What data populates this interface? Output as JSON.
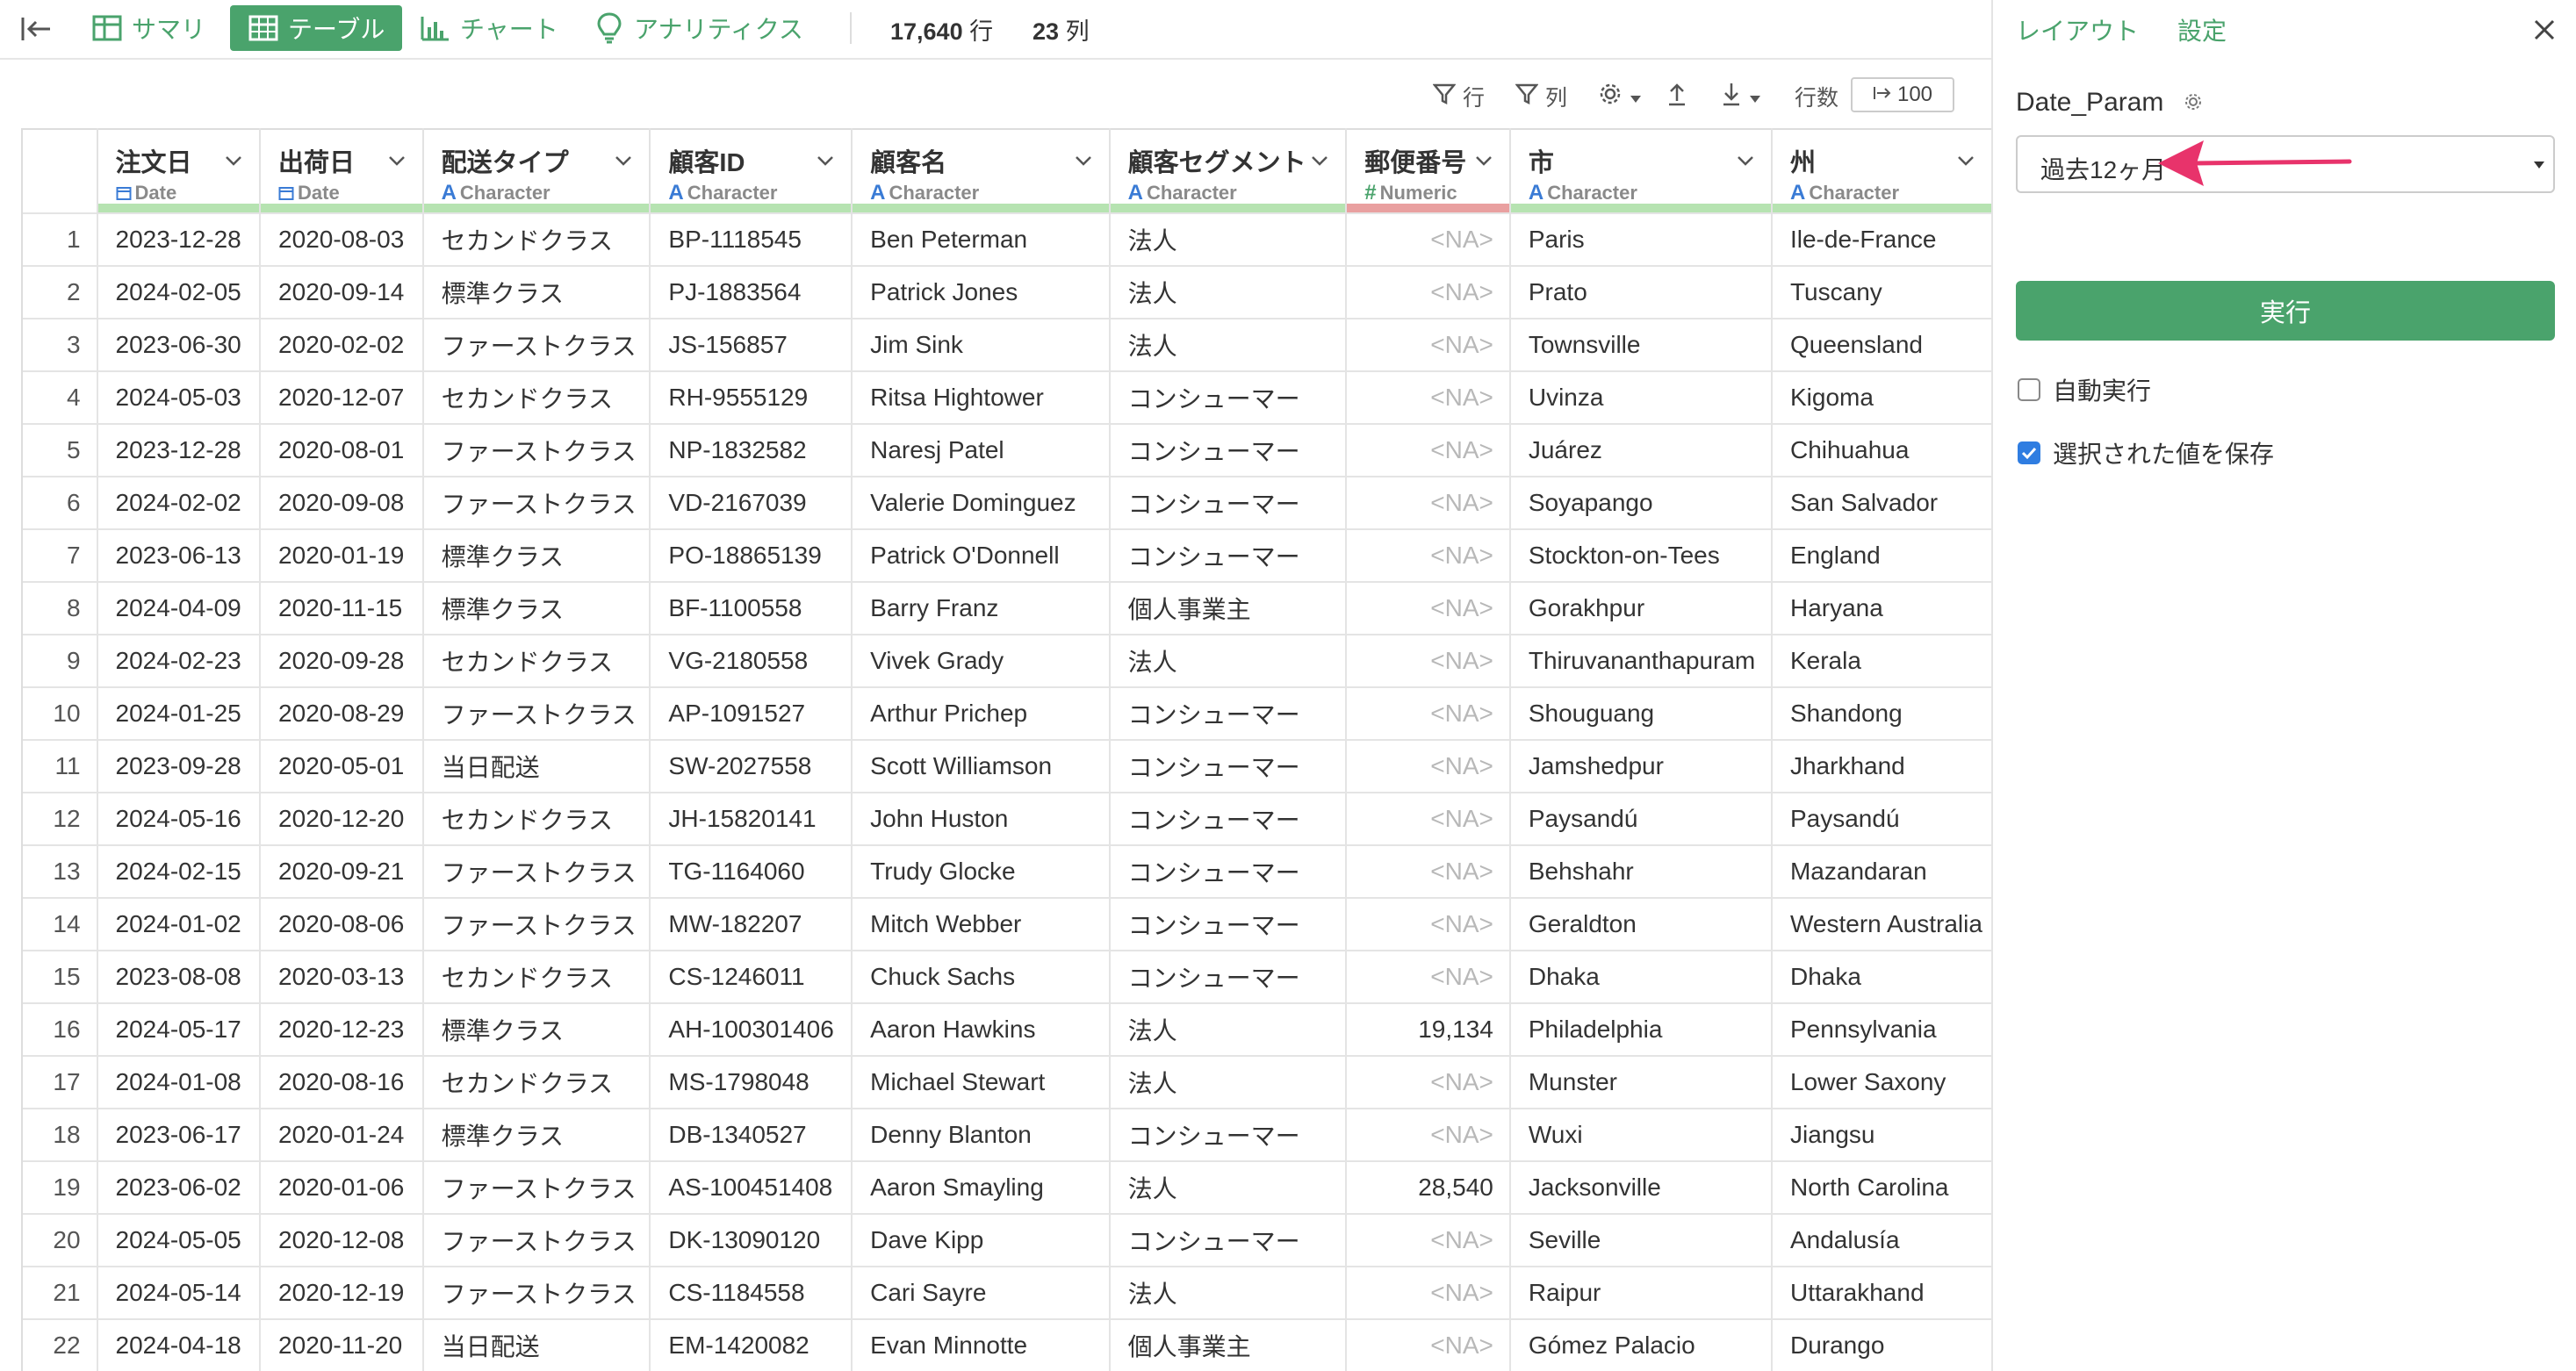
{
  "toolbar": {
    "summary": "サマリ",
    "table": "テーブル",
    "chart": "チャート",
    "analytics": "アナリティクス",
    "rows_value": "17,640",
    "rows_unit": "行",
    "cols_value": "23",
    "cols_unit": "列"
  },
  "subtoolbar": {
    "row_filter": "行",
    "col_filter": "列",
    "rows_label": "行数",
    "limit": "100"
  },
  "table": {
    "columns": [
      {
        "name": "注文日",
        "type": "Date"
      },
      {
        "name": "出荷日",
        "type": "Date"
      },
      {
        "name": "配送タイプ",
        "type": "Character"
      },
      {
        "name": "顧客ID",
        "type": "Character"
      },
      {
        "name": "顧客名",
        "type": "Character"
      },
      {
        "name": "顧客セグメント",
        "type": "Character"
      },
      {
        "name": "郵便番号",
        "type": "Numeric"
      },
      {
        "name": "市",
        "type": "Character"
      },
      {
        "name": "州",
        "type": "Character"
      }
    ],
    "rows": [
      [
        "1",
        "2023-12-28",
        "2020-08-03",
        "セカンドクラス",
        "BP-1118545",
        "Ben Peterman",
        "法人",
        "<NA>",
        "Paris",
        "Ile-de-France"
      ],
      [
        "2",
        "2024-02-05",
        "2020-09-14",
        "標準クラス",
        "PJ-1883564",
        "Patrick Jones",
        "法人",
        "<NA>",
        "Prato",
        "Tuscany"
      ],
      [
        "3",
        "2023-06-30",
        "2020-02-02",
        "ファーストクラス",
        "JS-156857",
        "Jim Sink",
        "法人",
        "<NA>",
        "Townsville",
        "Queensland"
      ],
      [
        "4",
        "2024-05-03",
        "2020-12-07",
        "セカンドクラス",
        "RH-9555129",
        "Ritsa Hightower",
        "コンシューマー",
        "<NA>",
        "Uvinza",
        "Kigoma"
      ],
      [
        "5",
        "2023-12-28",
        "2020-08-01",
        "ファーストクラス",
        "NP-1832582",
        "Naresj Patel",
        "コンシューマー",
        "<NA>",
        "Juárez",
        "Chihuahua"
      ],
      [
        "6",
        "2024-02-02",
        "2020-09-08",
        "ファーストクラス",
        "VD-2167039",
        "Valerie Dominguez",
        "コンシューマー",
        "<NA>",
        "Soyapango",
        "San Salvador"
      ],
      [
        "7",
        "2023-06-13",
        "2020-01-19",
        "標準クラス",
        "PO-18865139",
        "Patrick O'Donnell",
        "コンシューマー",
        "<NA>",
        "Stockton-on-Tees",
        "England"
      ],
      [
        "8",
        "2024-04-09",
        "2020-11-15",
        "標準クラス",
        "BF-1100558",
        "Barry Franz",
        "個人事業主",
        "<NA>",
        "Gorakhpur",
        "Haryana"
      ],
      [
        "9",
        "2024-02-23",
        "2020-09-28",
        "セカンドクラス",
        "VG-2180558",
        "Vivek Grady",
        "法人",
        "<NA>",
        "Thiruvananthapuram",
        "Kerala"
      ],
      [
        "10",
        "2024-01-25",
        "2020-08-29",
        "ファーストクラス",
        "AP-1091527",
        "Arthur Prichep",
        "コンシューマー",
        "<NA>",
        "Shouguang",
        "Shandong"
      ],
      [
        "11",
        "2023-09-28",
        "2020-05-01",
        "当日配送",
        "SW-2027558",
        "Scott Williamson",
        "コンシューマー",
        "<NA>",
        "Jamshedpur",
        "Jharkhand"
      ],
      [
        "12",
        "2024-05-16",
        "2020-12-20",
        "セカンドクラス",
        "JH-15820141",
        "John Huston",
        "コンシューマー",
        "<NA>",
        "Paysandú",
        "Paysandú"
      ],
      [
        "13",
        "2024-02-15",
        "2020-09-21",
        "ファーストクラス",
        "TG-1164060",
        "Trudy Glocke",
        "コンシューマー",
        "<NA>",
        "Behshahr",
        "Mazandaran"
      ],
      [
        "14",
        "2024-01-02",
        "2020-08-06",
        "ファーストクラス",
        "MW-182207",
        "Mitch Webber",
        "コンシューマー",
        "<NA>",
        "Geraldton",
        "Western Australia"
      ],
      [
        "15",
        "2023-08-08",
        "2020-03-13",
        "セカンドクラス",
        "CS-1246011",
        "Chuck Sachs",
        "コンシューマー",
        "<NA>",
        "Dhaka",
        "Dhaka"
      ],
      [
        "16",
        "2024-05-17",
        "2020-12-23",
        "標準クラス",
        "AH-100301406",
        "Aaron Hawkins",
        "法人",
        "19,134",
        "Philadelphia",
        "Pennsylvania"
      ],
      [
        "17",
        "2024-01-08",
        "2020-08-16",
        "セカンドクラス",
        "MS-1798048",
        "Michael Stewart",
        "法人",
        "<NA>",
        "Munster",
        "Lower Saxony"
      ],
      [
        "18",
        "2023-06-17",
        "2020-01-24",
        "標準クラス",
        "DB-1340527",
        "Denny Blanton",
        "コンシューマー",
        "<NA>",
        "Wuxi",
        "Jiangsu"
      ],
      [
        "19",
        "2023-06-02",
        "2020-01-06",
        "ファーストクラス",
        "AS-100451408",
        "Aaron Smayling",
        "法人",
        "28,540",
        "Jacksonville",
        "North Carolina"
      ],
      [
        "20",
        "2024-05-05",
        "2020-12-08",
        "ファーストクラス",
        "DK-13090120",
        "Dave Kipp",
        "コンシューマー",
        "<NA>",
        "Seville",
        "Andalusía"
      ],
      [
        "21",
        "2024-05-14",
        "2020-12-19",
        "ファーストクラス",
        "CS-1184558",
        "Cari Sayre",
        "法人",
        "<NA>",
        "Raipur",
        "Uttarakhand"
      ],
      [
        "22",
        "2024-04-18",
        "2020-11-20",
        "当日配送",
        "EM-1420082",
        "Evan Minnotte",
        "個人事業主",
        "<NA>",
        "Gómez Palacio",
        "Durango"
      ]
    ]
  },
  "panel": {
    "tab_layout": "レイアウト",
    "tab_settings": "設定",
    "param_label": "Date_Param",
    "param_value": "過去12ヶ月",
    "run_label": "実行",
    "auto_run": "自動実行",
    "save_selected": "選択された値を保存"
  },
  "colors": {
    "accent": "#4aa36c",
    "arrow": "#e8336b",
    "checkbox": "#2f7de1"
  }
}
